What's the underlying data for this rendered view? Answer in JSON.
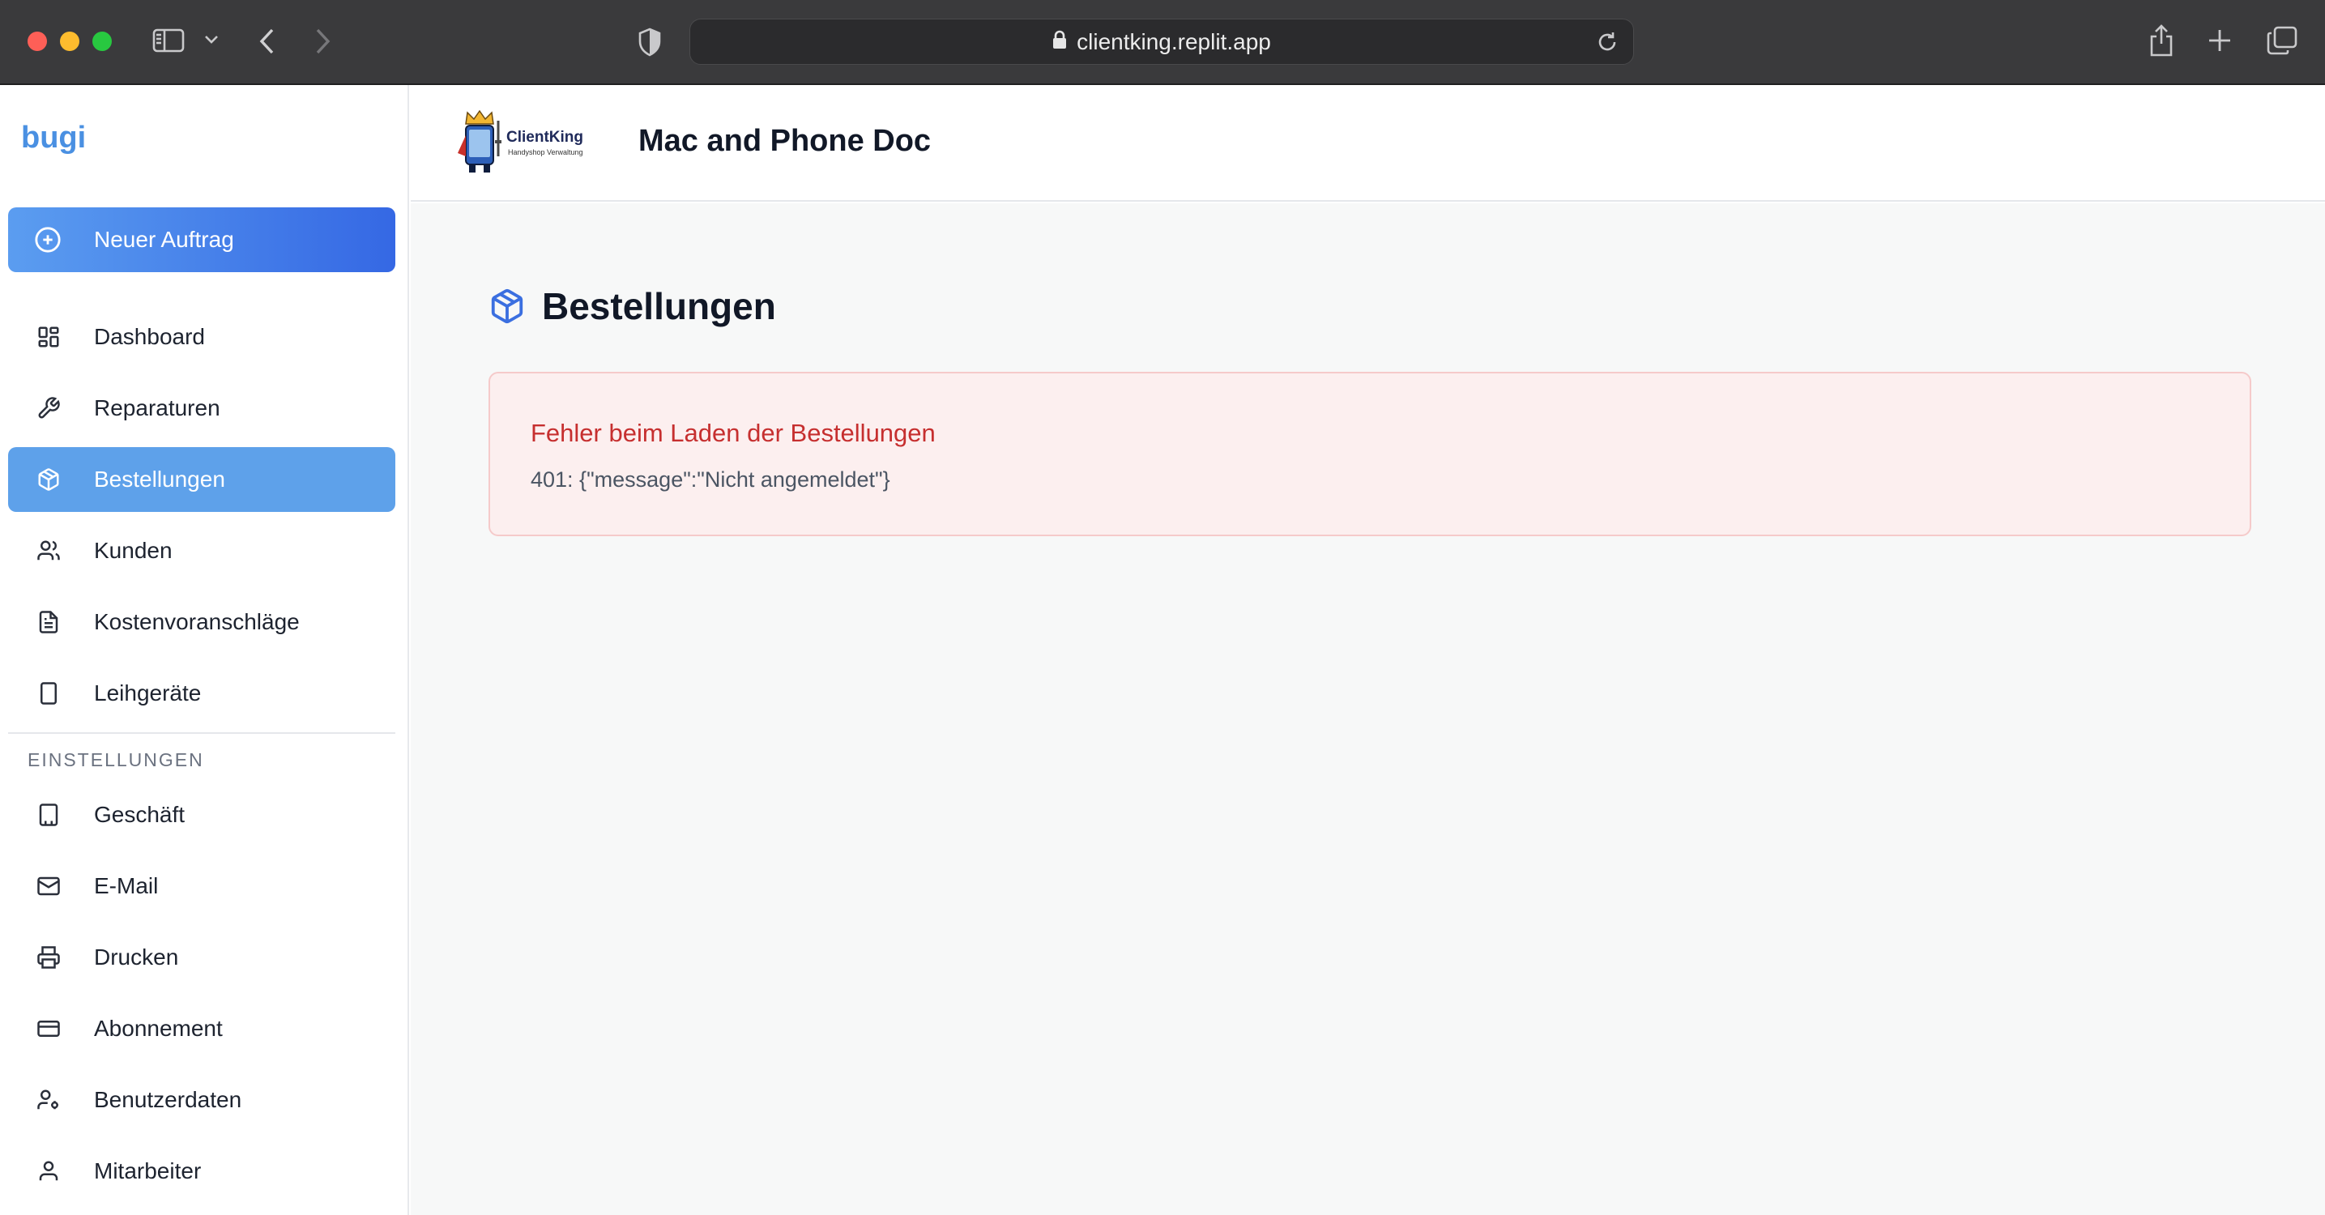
{
  "browser": {
    "url": "clientking.replit.app"
  },
  "sidebar": {
    "brand": "bugi",
    "new_order_label": "Neuer Auftrag",
    "items": [
      {
        "label": "Dashboard",
        "icon": "dashboard-icon"
      },
      {
        "label": "Reparaturen",
        "icon": "wrench-icon"
      },
      {
        "label": "Bestellungen",
        "icon": "package-icon",
        "active": true
      },
      {
        "label": "Kunden",
        "icon": "users-icon"
      },
      {
        "label": "Kostenvoranschläge",
        "icon": "document-icon"
      },
      {
        "label": "Leihgeräte",
        "icon": "tablet-icon"
      }
    ],
    "settings_heading": "EINSTELLUNGEN",
    "settings_items": [
      {
        "label": "Geschäft",
        "icon": "building-icon"
      },
      {
        "label": "E-Mail",
        "icon": "mail-icon"
      },
      {
        "label": "Drucken",
        "icon": "printer-icon"
      },
      {
        "label": "Abonnement",
        "icon": "credit-card-icon"
      },
      {
        "label": "Benutzerdaten",
        "icon": "user-settings-icon"
      },
      {
        "label": "Mitarbeiter",
        "icon": "user-icon"
      }
    ]
  },
  "header": {
    "logo_title": "ClientKing",
    "logo_subtitle": "Handyshop Verwaltung",
    "shop_name": "Mac and Phone Doc"
  },
  "main": {
    "title": "Bestellungen",
    "error": {
      "title": "Fehler beim Laden der Bestellungen",
      "message": "401: {\"message\":\"Nicht angemeldet\"}"
    }
  },
  "colors": {
    "accent": "#3b6fe0",
    "brand": "#4a90e2",
    "active_nav": "#5ea1ea",
    "error_text": "#c62f2f",
    "error_bg": "#fcefef"
  }
}
